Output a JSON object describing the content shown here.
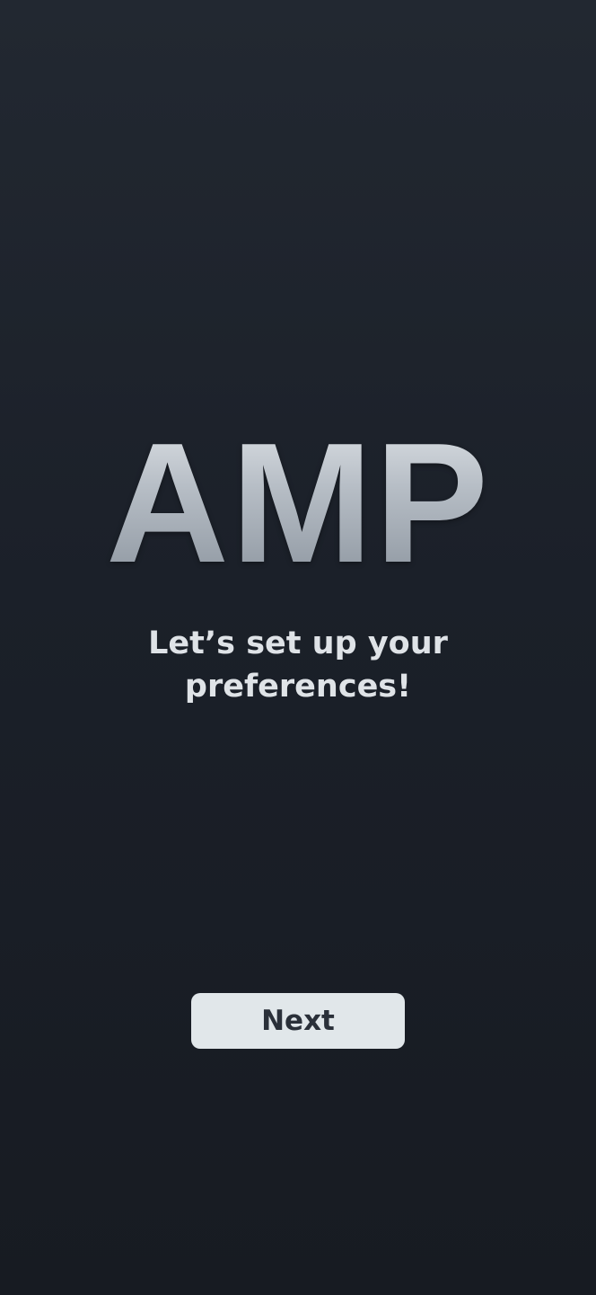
{
  "app": {
    "logo_text": "AMP"
  },
  "onboarding": {
    "headline_line1": "Let’s set up your",
    "headline_line2": "preferences!"
  },
  "actions": {
    "next_label": "Next"
  },
  "colors": {
    "background_top": "#222831",
    "background_bottom": "#171b22",
    "text_light": "#dfe3e7",
    "button_bg": "#e1e7ea",
    "button_text": "#2a3039"
  }
}
